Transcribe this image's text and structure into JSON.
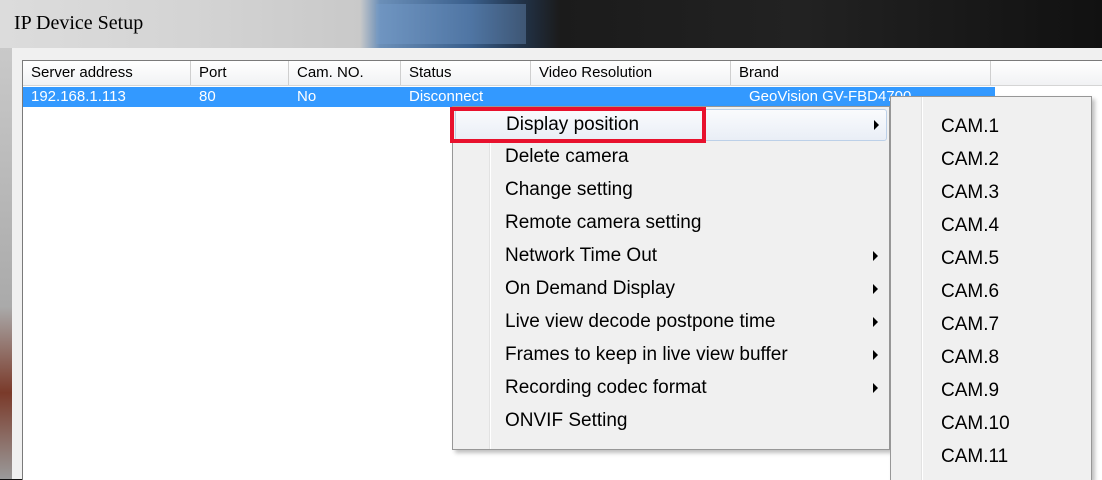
{
  "window": {
    "title": "IP Device Setup"
  },
  "table": {
    "columns": [
      "Server address",
      "Port",
      "Cam. NO.",
      "Status",
      "Video Resolution",
      "Brand"
    ],
    "rows": [
      {
        "server_address": "192.168.1.113",
        "port": "80",
        "cam_no": "No",
        "status": "Disconnect",
        "video_resolution": "",
        "brand": "GeoVision GV-FBD4700"
      }
    ]
  },
  "context_menu": {
    "items": [
      {
        "label": "Display position",
        "has_submenu": true
      },
      {
        "label": "Delete camera",
        "has_submenu": false
      },
      {
        "label": "Change setting",
        "has_submenu": false
      },
      {
        "label": "Remote camera setting",
        "has_submenu": false
      },
      {
        "label": "Network Time Out",
        "has_submenu": true
      },
      {
        "label": "On Demand Display",
        "has_submenu": true
      },
      {
        "label": "Live view decode postpone time",
        "has_submenu": true
      },
      {
        "label": "Frames to keep in live view buffer",
        "has_submenu": true
      },
      {
        "label": "Recording codec format",
        "has_submenu": true
      },
      {
        "label": "ONVIF Setting",
        "has_submenu": false
      }
    ],
    "highlight_color": "#e8112d"
  },
  "submenu": {
    "items": [
      "CAM.1",
      "CAM.2",
      "CAM.3",
      "CAM.4",
      "CAM.5",
      "CAM.6",
      "CAM.7",
      "CAM.8",
      "CAM.9",
      "CAM.10",
      "CAM.11"
    ]
  },
  "colors": {
    "selection": "#3399ff"
  }
}
